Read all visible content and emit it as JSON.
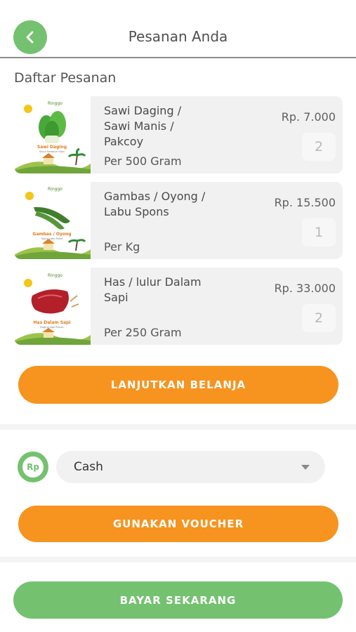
{
  "header": {
    "title": "Pesanan Anda",
    "back_icon": "chevron-left-icon"
  },
  "section_title": "Daftar Pesanan",
  "items": [
    {
      "name": "Sawi Daging /\nSawi Manis /\nPakcoy",
      "unit": "Per 500 Gram",
      "price": "Rp. 7.000",
      "qty": "2",
      "thumb_brand": "Ringgo",
      "thumb_label": "Sawi Daging",
      "thumb_sub": "Sayur Berdaun Hijau"
    },
    {
      "name": "Gambas / Oyong /\nLabu Spons",
      "unit": "Per Kg",
      "price": "Rp. 15.500",
      "qty": "1",
      "thumb_brand": "Ringgo",
      "thumb_label": "Gambas / Oyong",
      "thumb_sub": "Sayur Labu Pasar"
    },
    {
      "name": "Has / lulur Dalam\nSapi",
      "unit": "Per 250 Gram",
      "price": "Rp. 33.000",
      "qty": "2",
      "thumb_brand": "Ringgo",
      "thumb_label": "Has Dalam Sapi",
      "thumb_sub": "Daging sapi Pilihan"
    }
  ],
  "buttons": {
    "continue_shopping": "LANJUTKAN BELANJA",
    "use_voucher": "GUNAKAN VOUCHER",
    "pay_now": "BAYAR SEKARANG"
  },
  "payment": {
    "icon_text": "Rp",
    "method": "Cash"
  },
  "colors": {
    "green": "#74c26f",
    "orange": "#f7931f",
    "card": "#f1f1f1"
  }
}
